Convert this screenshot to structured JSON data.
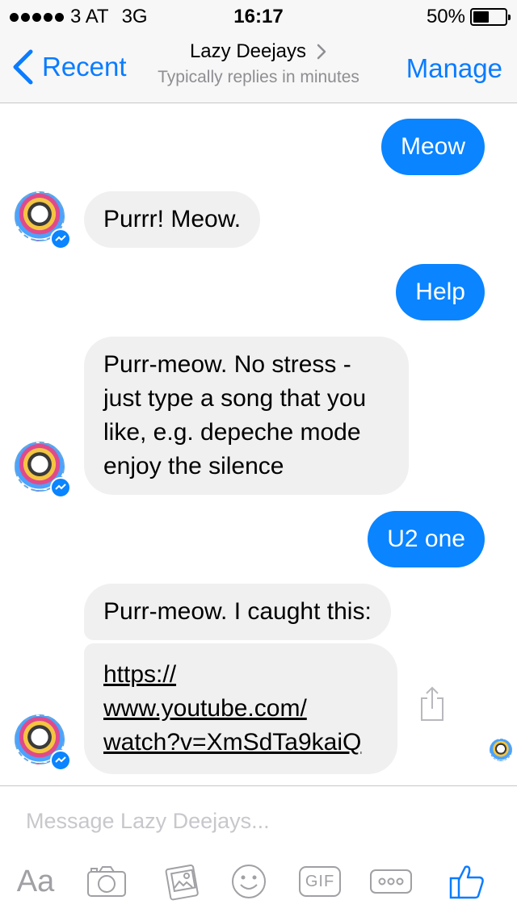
{
  "status_bar": {
    "carrier": "3 AT",
    "network": "3G",
    "time": "16:17",
    "battery_text": "50%",
    "battery_level": 0.5
  },
  "nav": {
    "back_label": "Recent",
    "title": "Lazy Deejays",
    "subtitle": "Typically replies in minutes",
    "manage_label": "Manage"
  },
  "messages": [
    {
      "from": "me",
      "text": "Meow"
    },
    {
      "from": "bot",
      "text": "Purrr! Meow."
    },
    {
      "from": "me",
      "text": "Help"
    },
    {
      "from": "bot",
      "lines": [
        "Purr-meow. No stress -",
        "just type a song that you",
        "like, e.g. depeche mode",
        "enjoy the silence"
      ]
    },
    {
      "from": "me",
      "text": "U2 one"
    },
    {
      "from": "bot",
      "text": "Purr-meow. I caught this:"
    },
    {
      "from": "bot",
      "link_lines": [
        "https://",
        "www.youtube.com/",
        "watch?v=XmSdTa9kaiQ"
      ]
    }
  ],
  "composer": {
    "placeholder": "Message Lazy Deejays...",
    "aa_label": "Aa",
    "gif_label": "GIF"
  },
  "colors": {
    "accent": "#0a7cff",
    "outgoing_bubble": "#0a84ff",
    "incoming_bubble": "#f0f0f0",
    "toolbar_icon": "#a0a0a5"
  },
  "icons": [
    "back-chevron-icon",
    "chevron-right-icon",
    "messenger-badge-icon",
    "share-icon",
    "camera-icon",
    "photo-icon",
    "emoji-icon",
    "gif-icon",
    "more-icon",
    "like-icon"
  ]
}
